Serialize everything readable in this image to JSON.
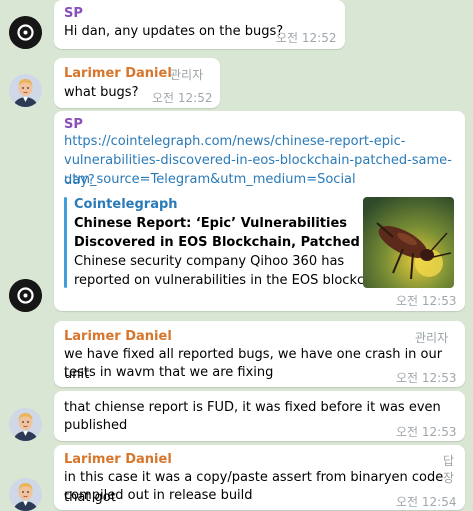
{
  "messages": [
    {
      "sender": "SP",
      "text": "Hi dan, any updates on the bugs?",
      "time": "오전 12:52"
    },
    {
      "sender": "Larimer Daniel",
      "badge": "관리자",
      "text": "what bugs?",
      "time": "오전 12:52"
    },
    {
      "sender": "SP",
      "link_line1": "https://cointelegraph.com/news/chinese-report-epic-",
      "link_line2": "vulnerabilities-discovered-in-eos-blockchain-patched-same-day?",
      "link_line3": "utm_source=Telegram&utm_medium=Social",
      "preview": {
        "site": "Cointelegraph",
        "title_line1": "Chinese Report: ‘Epic’ Vulnerabilities",
        "title_line2": "Discovered in EOS Blockchain, Patched Sam...",
        "desc_line1": "Chinese security company Qihoo 360 has",
        "desc_line2": "reported on vulnerabilities in the EOS blockch..."
      },
      "time": "오전 12:53"
    },
    {
      "sender": "Larimer Daniel",
      "badge": "관리자",
      "text_line1": "we have fixed all reported bugs, we have one crash in our unit",
      "text_line2": "tests in wavm that we are fixing",
      "time": "오전 12:53"
    },
    {
      "text_line1": "that chiense report is FUD, it was fixed before it was even",
      "text_line2": "published",
      "time": "오전 12:53"
    },
    {
      "sender": "Larimer Daniel",
      "badge": "답장",
      "text_line1": "in this case it was a copy/paste assert from binaryen code that got",
      "text_line2": "compiled out in release build",
      "time": "오전 12:54"
    }
  ]
}
